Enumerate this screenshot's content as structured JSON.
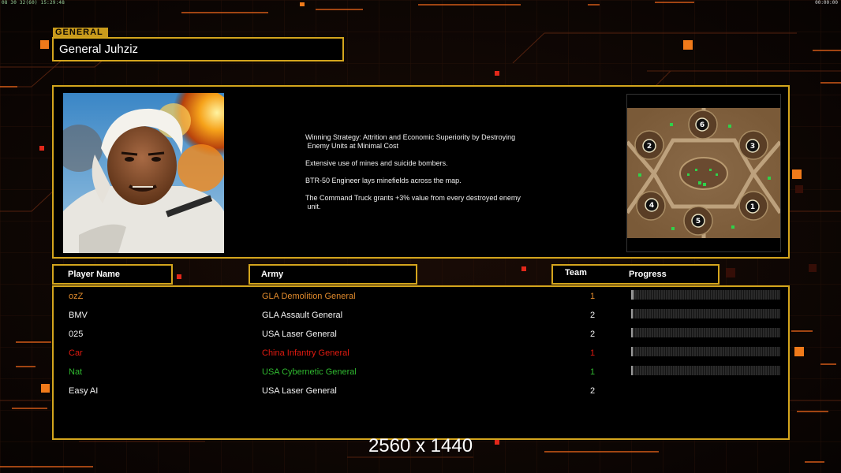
{
  "status_bar": {
    "left": "08 30 32(60) 15:29:48",
    "right": "00:00:00"
  },
  "header": {
    "tag": "GENERAL",
    "general_name": "General Juhziz"
  },
  "strategy": {
    "paragraphs": [
      "Winning Strategy: Attrition and Economic Superiority by Destroying\n Enemy Units at Minimal Cost",
      "Extensive use of mines and suicide bombers.",
      "BTR-50 Engineer lays minefields across the map.",
      "The Command Truck grants +3% value from every destroyed enemy\n unit."
    ]
  },
  "minimap": {
    "start_positions": [
      "1",
      "2",
      "3",
      "4",
      "5",
      "6"
    ]
  },
  "columns": {
    "player_name": "Player Name",
    "army": "Army",
    "team": "Team",
    "progress": "Progress"
  },
  "players": [
    {
      "name": "ozZ",
      "army": "GLA Demolition General",
      "team": "1",
      "color": "#e08a2c",
      "progress": 0.01
    },
    {
      "name": "BMV",
      "army": "GLA Assault General",
      "team": "2",
      "color": "#f2f2f2",
      "progress": 0
    },
    {
      "name": "025",
      "army": "USA Laser General",
      "team": "2",
      "color": "#f2f2f2",
      "progress": 0
    },
    {
      "name": "Car",
      "army": "China Infantry General",
      "team": "1",
      "color": "#e01a10",
      "progress": 0
    },
    {
      "name": "Nat",
      "army": "USA Cybernetic General",
      "team": "1",
      "color": "#2fb82f",
      "progress": 0
    },
    {
      "name": "Easy AI",
      "army": "USA Laser General",
      "team": "2",
      "color": "#f2f2f2",
      "progress": null
    }
  ],
  "footer": {
    "resolution": "2560 x 1440"
  },
  "colors": {
    "accent_gold": "#d4a51d",
    "bg_orange": "#e8641a"
  }
}
